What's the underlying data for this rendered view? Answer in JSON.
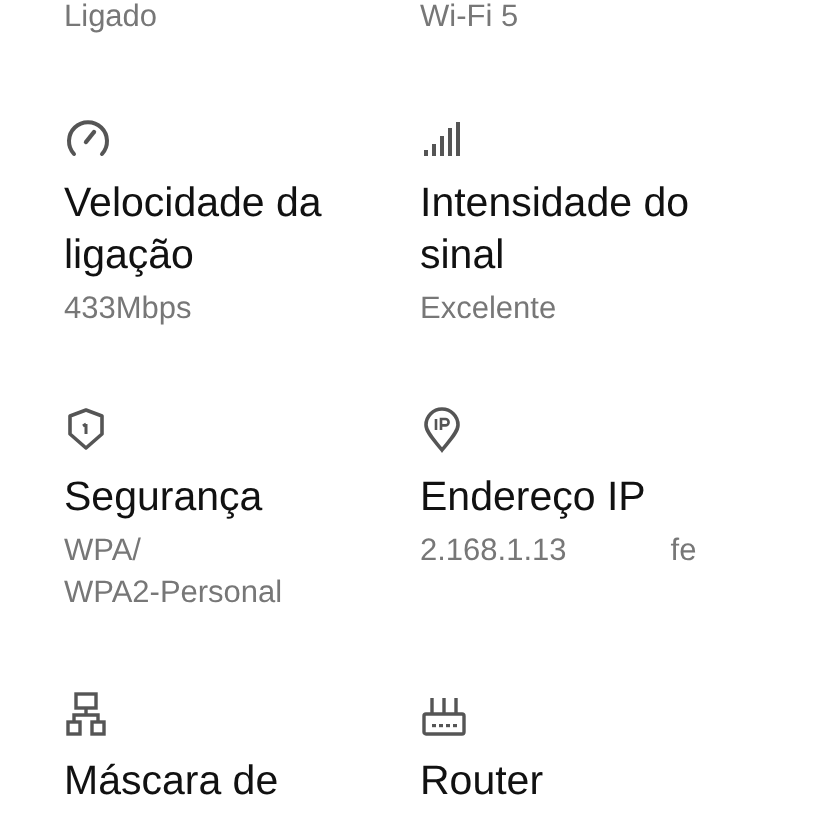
{
  "top_values": [
    "Ligado",
    "Wi-Fi 5"
  ],
  "items": [
    {
      "kind": "speedometer",
      "title": "Velocidade da ligação",
      "values": [
        "433Mbps"
      ]
    },
    {
      "kind": "signal",
      "title": "Intensidade do sinal",
      "values": [
        "Excelente"
      ]
    },
    {
      "kind": "shield",
      "title": "Segurança",
      "values": [
        "WPA/",
        "WPA2-Personal"
      ]
    },
    {
      "kind": "pin",
      "title": "Endereço IP",
      "scroll_values": [
        "2.168.1.13",
        "fe"
      ]
    },
    {
      "kind": "network",
      "title": "Máscara de"
    },
    {
      "kind": "router",
      "title": "Router"
    }
  ]
}
